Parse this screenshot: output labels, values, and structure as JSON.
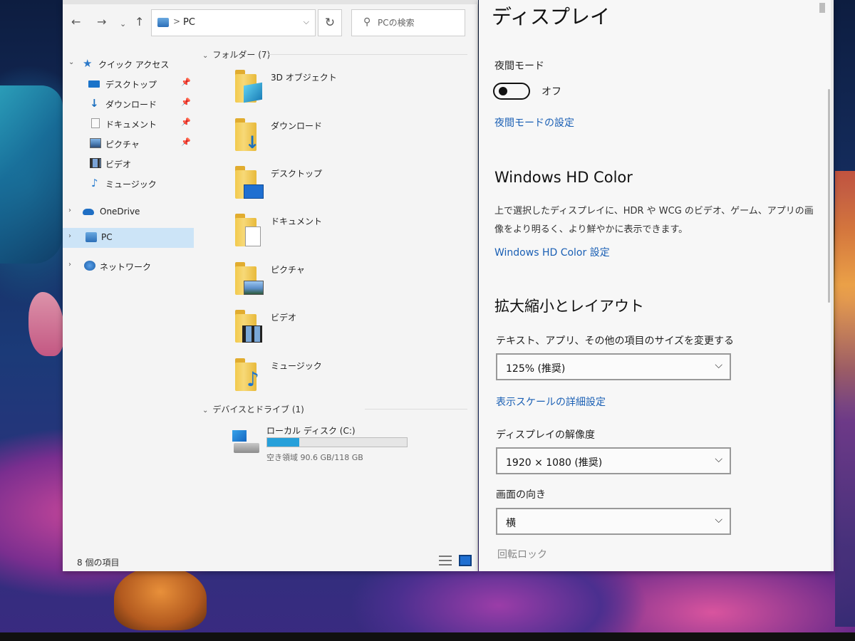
{
  "explorer": {
    "address": {
      "location": "PC",
      "separator": ">"
    },
    "search": {
      "placeholder": "PCの検索"
    },
    "nav": {
      "quick_access": "クイック アクセス",
      "desktop": "デスクトップ",
      "downloads": "ダウンロード",
      "documents": "ドキュメント",
      "pictures": "ピクチャ",
      "videos": "ビデオ",
      "music": "ミュージック",
      "onedrive": "OneDrive",
      "pc": "PC",
      "network": "ネットワーク"
    },
    "folders_group": "フォルダー (7)",
    "folders": [
      {
        "label": "3D オブジェクト",
        "icon": "3d-objects-folder-icon"
      },
      {
        "label": "ダウンロード",
        "icon": "downloads-folder-icon"
      },
      {
        "label": "デスクトップ",
        "icon": "desktop-folder-icon"
      },
      {
        "label": "ドキュメント",
        "icon": "documents-folder-icon"
      },
      {
        "label": "ピクチャ",
        "icon": "pictures-folder-icon"
      },
      {
        "label": "ビデオ",
        "icon": "videos-folder-icon"
      },
      {
        "label": "ミュージック",
        "icon": "music-folder-icon"
      }
    ],
    "devices_group": "デバイスとドライブ (1)",
    "drive": {
      "name": "ローカル ディスク (C:)",
      "free": "空き領域 90.6 GB/118 GB",
      "used_fraction": 0.23
    },
    "status": "8 個の項目"
  },
  "settings": {
    "title": "ディスプレイ",
    "night_mode_label": "夜間モード",
    "night_mode_state": "オフ",
    "night_mode_link": "夜間モードの設定",
    "hdr_heading": "Windows HD Color",
    "hdr_desc": "上で選択したディスプレイに、HDR や WCG のビデオ、ゲーム、アプリの画像をより明るく、より鮮やかに表示できます。",
    "hdr_link": "Windows HD Color 設定",
    "scale_heading": "拡大縮小とレイアウト",
    "scale_label": "テキスト、アプリ、その他の項目のサイズを変更する",
    "scale_value": "125% (推奨)",
    "scale_link": "表示スケールの詳細設定",
    "resolution_label": "ディスプレイの解像度",
    "resolution_value": "1920 × 1080 (推奨)",
    "orientation_label": "画面の向き",
    "orientation_value": "横",
    "rotation_lock_label": "回転ロック"
  }
}
